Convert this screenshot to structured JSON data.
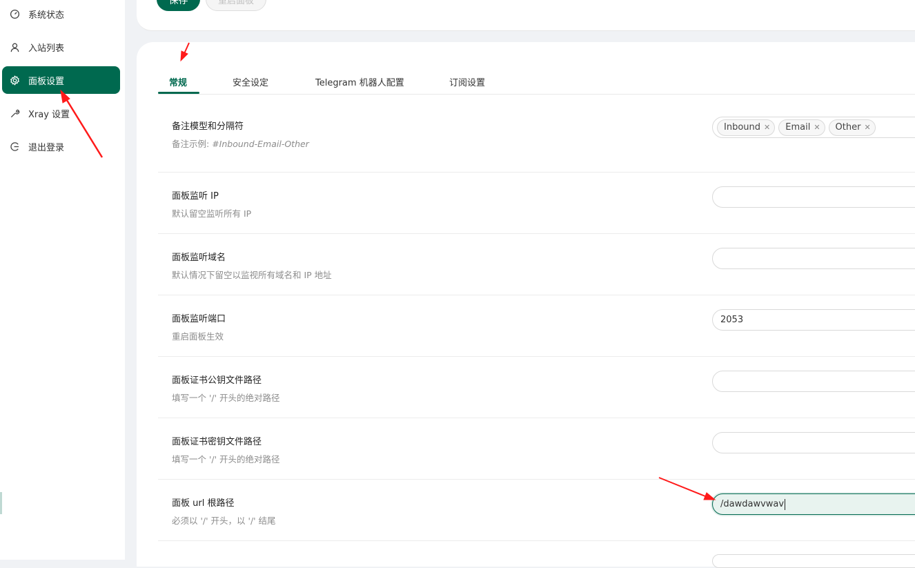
{
  "sidebar": {
    "items": [
      {
        "label": "系统状态",
        "icon": "dashboard-icon"
      },
      {
        "label": "入站列表",
        "icon": "user-icon"
      },
      {
        "label": "面板设置",
        "icon": "gear-icon",
        "active": true
      },
      {
        "label": "Xray 设置",
        "icon": "wrench-icon"
      },
      {
        "label": "退出登录",
        "icon": "logout-icon"
      }
    ]
  },
  "toolbar": {
    "save_label": "保存",
    "restart_label": "重启面板"
  },
  "tabs": [
    "常规",
    "安全设定",
    "Telegram 机器人配置",
    "订阅设置"
  ],
  "settings": {
    "remark": {
      "title": "备注模型和分隔符",
      "desc_prefix": "备注示例: ",
      "desc_example": "#Inbound-Email-Other",
      "tags": [
        "Inbound",
        "Email",
        "Other"
      ]
    },
    "listen_ip": {
      "title": "面板监听 IP",
      "desc": "默认留空监听所有 IP",
      "value": ""
    },
    "listen_domain": {
      "title": "面板监听域名",
      "desc": "默认情况下留空以监视所有域名和 IP 地址",
      "value": ""
    },
    "listen_port": {
      "title": "面板监听端口",
      "desc": "重启面板生效",
      "value": "2053"
    },
    "cert_public": {
      "title": "面板证书公钥文件路径",
      "desc": "填写一个 '/' 开头的绝对路径",
      "value": ""
    },
    "cert_key": {
      "title": "面板证书密钥文件路径",
      "desc": "填写一个 '/' 开头的绝对路径",
      "value": ""
    },
    "base_path": {
      "title": "面板 url 根路径",
      "desc": "必须以 '/' 开头，以 '/' 结尾",
      "value": "/dawdawvwav"
    }
  },
  "colors": {
    "accent": "#00694f",
    "annotation_arrow": "#ff1a1a"
  }
}
